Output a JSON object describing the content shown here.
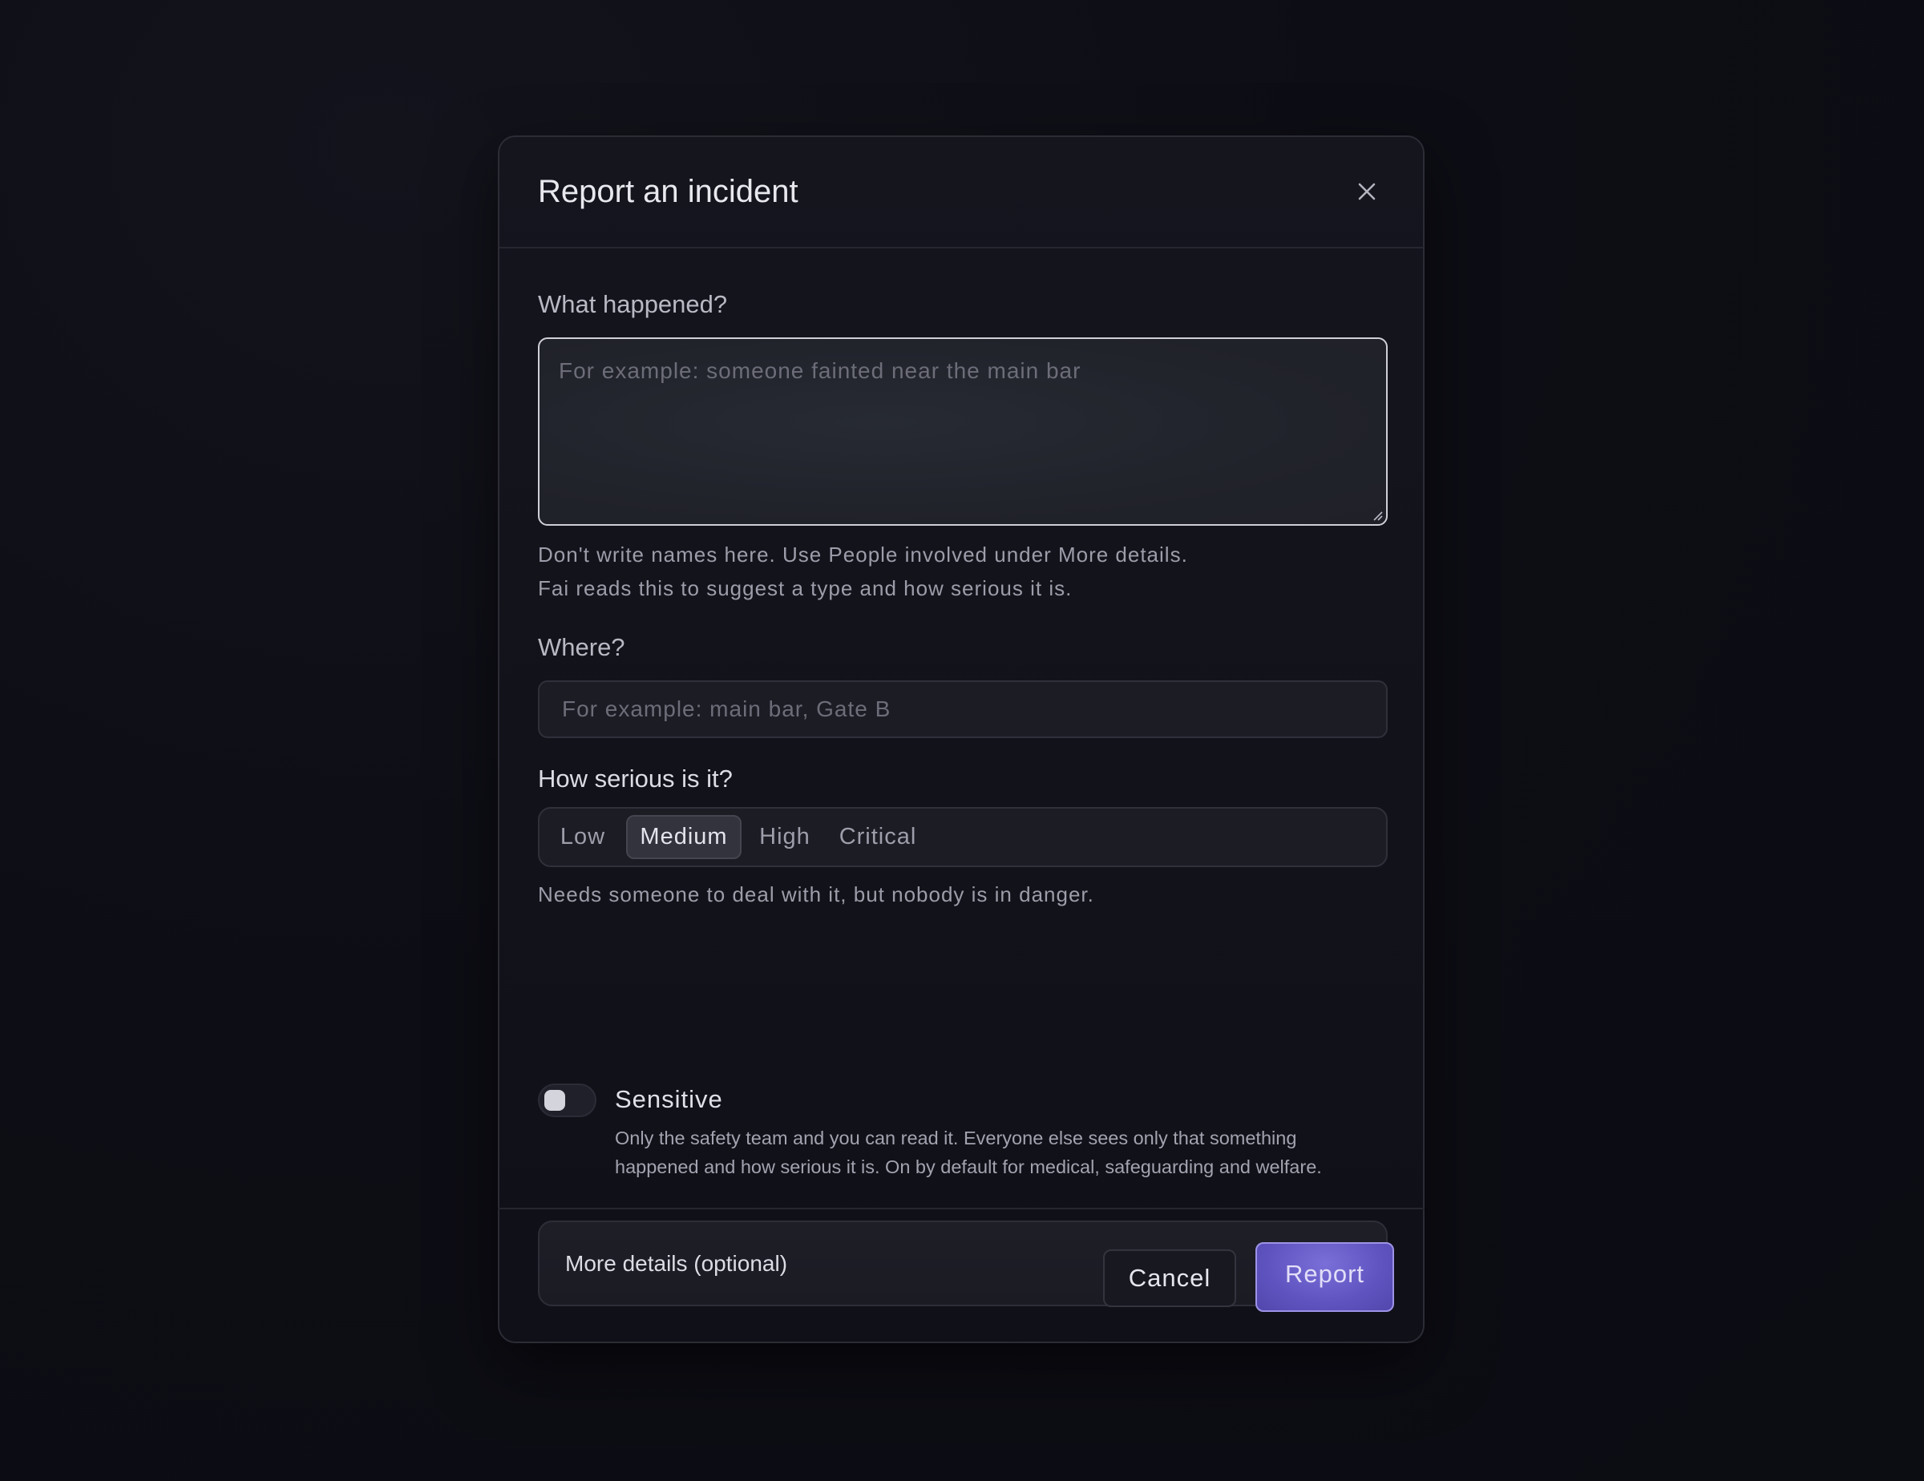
{
  "dialog": {
    "title": "Report an incident",
    "close_icon": "close-icon"
  },
  "what_happened": {
    "label": "What happened?",
    "placeholder": "For example: someone fainted near the main bar",
    "value": "",
    "hint_line1": "Don't write names here. Use People involved under More details.",
    "hint_line2": "Fai reads this to suggest a type and how serious it is."
  },
  "where": {
    "label": "Where?",
    "placeholder": "For example: main bar, Gate B",
    "value": ""
  },
  "severity": {
    "label": "How serious is it?",
    "options": [
      "Low",
      "Medium",
      "High",
      "Critical"
    ],
    "selected": "Medium",
    "description": "Needs someone to deal with it, but nobody is in danger."
  },
  "sensitive": {
    "label": "Sensitive",
    "on": false,
    "description": "Only the safety team and you can read it. Everyone else sees only that something happened and how serious it is. On by default for medical, safeguarding and welfare."
  },
  "more_details": {
    "label": "More details (optional)"
  },
  "footer": {
    "cancel_label": "Cancel",
    "report_label": "Report"
  },
  "colors": {
    "accent": "#6a5fcf",
    "background": "#0d0d15",
    "panel": "#13131b"
  }
}
